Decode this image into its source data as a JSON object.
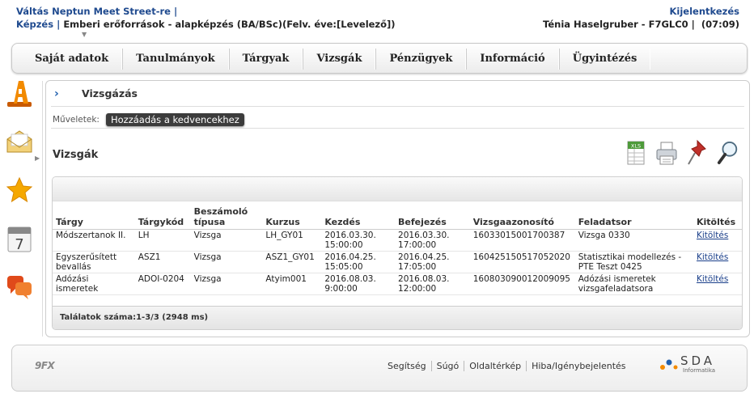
{
  "header": {
    "title": "Váltás Neptun Meet Street-re",
    "training_label": "Képzés",
    "training_value": "Emberi erőforrások - alapképzés (BA/BSc)(Felv. éve:[Levelező])",
    "logout": "Kijelentkezés",
    "user": "Ténia Haselgruber - F7GLC0",
    "timer": "(07:09)"
  },
  "menu": [
    "Saját adatok",
    "Tanulmányok",
    "Tárgyak",
    "Vizsgák",
    "Pénzügyek",
    "Információ",
    "Ügyintézés"
  ],
  "panel": {
    "title": "Vizsgázás",
    "ops_label": "Műveletek:",
    "fav_button": "Hozzáadás a kedvencekhez",
    "section_title": "Vizsgák"
  },
  "table": {
    "headers": [
      "Tárgy",
      "Tárgykód",
      "Beszámoló típusa",
      "Kurzus",
      "Kezdés",
      "Befejezés",
      "Vizsgaazonosító",
      "Feladatsor",
      "Kitöltés"
    ],
    "rows": [
      [
        "Módszertanok II.",
        "LH",
        "Vizsga",
        "LH_GY01",
        "2016.03.30. 15:00:00",
        "2016.03.30. 17:00:00",
        "16033015001700387",
        "Vizsga 0330",
        "Kitöltés"
      ],
      [
        "Egyszerűsített bevallás",
        "ASZ1",
        "Vizsga",
        "ASZ1_GY01",
        "2016.04.25. 15:05:00",
        "2016.04.25. 17:05:00",
        "160425150517052020",
        "Statisztikai modellezés - PTE Teszt 0425",
        "Kitöltés"
      ],
      [
        "Adózási ismeretek",
        "ADOI-0204",
        "Vizsga",
        "Atyim001",
        "2016.08.03. 9:00:00",
        "2016.08.03. 12:00:00",
        "160803090012009095",
        "Adózási ismeretek vizsgafeladatsora",
        "Kitöltés"
      ]
    ],
    "results": "Találatok száma:1-3/3 (2948 ms)"
  },
  "footer": {
    "links": [
      "Segítség",
      "Súgó",
      "Oldaltérkép",
      "Hiba/Igénybejelentés"
    ],
    "logo_left": "9FX",
    "logo_right": "SDA",
    "logo_right_sub": "Informatika"
  },
  "icons": {
    "sidebar": [
      "a-letter-icon",
      "envelope-icon",
      "star-icon",
      "calendar-icon",
      "chat-icon"
    ],
    "tools": [
      "xls-export-icon",
      "print-icon",
      "pin-icon",
      "search-icon"
    ]
  },
  "colors": {
    "brand_blue": "#1f4a8f",
    "orange": "#f28a00",
    "fav_button_bg": "#3c3c3c"
  }
}
